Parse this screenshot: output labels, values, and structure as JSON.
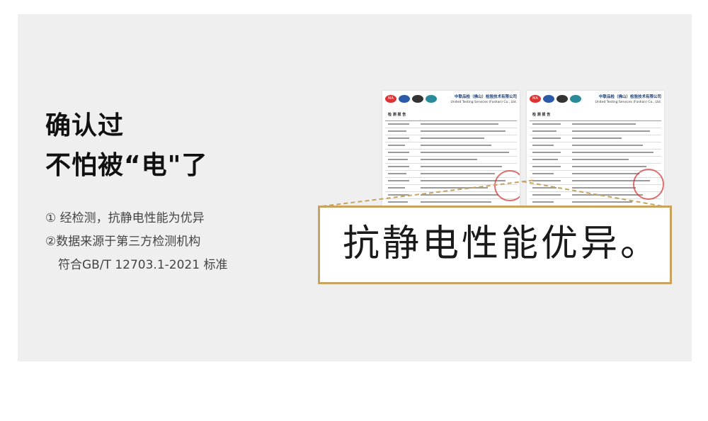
{
  "headline": {
    "line1": "确认过",
    "line2": "不怕被“电\"了"
  },
  "points": [
    "① 经检测，抗静电性能为优异",
    "②数据来源于第三方检测机构",
    "符合GB/T 12703.1-2021 标准"
  ],
  "callout": {
    "text": "抗静电性能优异。"
  },
  "report": {
    "lab_cn": "中联品检（佛山）检验技术有限公司",
    "lab_en": "United Testing Services (Foshan) Co., Ltd.",
    "title": "检 测 报 告"
  },
  "colors": {
    "accent": "#c8a35f",
    "panel": "#efefef",
    "stamp": "#d23232"
  }
}
